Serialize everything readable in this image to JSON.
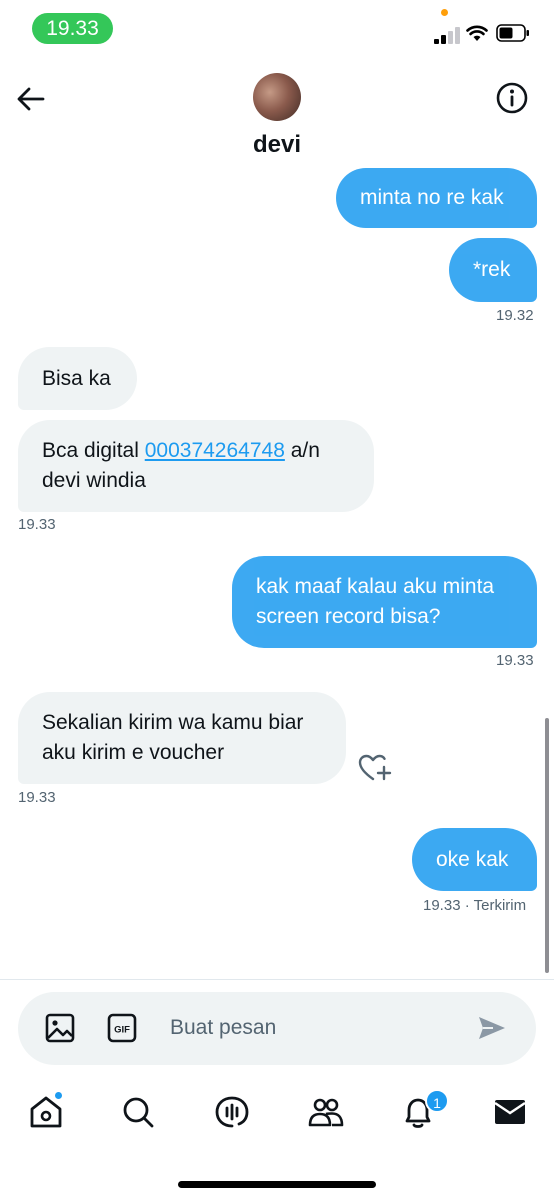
{
  "status_bar": {
    "time": "19.33"
  },
  "header": {
    "contact_name": "devi"
  },
  "messages": [
    {
      "direction": "out",
      "text": "minta no re kak"
    },
    {
      "direction": "out",
      "text": "*rek",
      "time": "19.32"
    },
    {
      "direction": "in",
      "text": "Bisa ka"
    },
    {
      "direction": "in",
      "text_before": "Bca digital ",
      "link": "000374264748",
      "text_after": " a/n",
      "line2": "devi windia",
      "time": "19.33"
    },
    {
      "direction": "out",
      "line1": "kak maaf kalau aku minta",
      "line2": "screen record bisa?",
      "time": "19.33"
    },
    {
      "direction": "in",
      "line1": "Sekalian kirim wa kamu biar",
      "line2": "aku kirim e voucher",
      "time": "19.33"
    },
    {
      "direction": "out",
      "text": "oke kak",
      "time": "19.33",
      "status": "· Terkirim"
    }
  ],
  "composer": {
    "placeholder": "Buat pesan",
    "gif_label": "GIF"
  },
  "tabbar": {
    "notification_count": "1"
  },
  "colors": {
    "accent": "#1d9bf0",
    "incoming_bubble": "#eff3f4",
    "status_time_bg": "#34c759"
  }
}
